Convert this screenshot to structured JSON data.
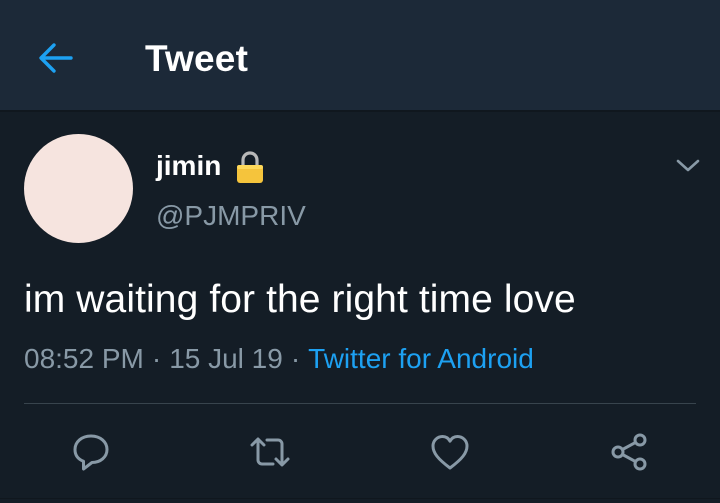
{
  "header": {
    "title": "Tweet",
    "back_icon": "arrow-left-icon"
  },
  "tweet": {
    "display_name": "jimin",
    "protected_icon": "lock-icon",
    "username": "@PJMPRIV",
    "text": "im waiting for the right time love",
    "time": "08:52 PM",
    "separator": "·",
    "date": "15 Jul 19",
    "source": "Twitter for Android",
    "more_icon": "chevron-down-icon"
  },
  "actions": [
    {
      "name": "reply",
      "icon": "reply-icon"
    },
    {
      "name": "retweet",
      "icon": "retweet-icon"
    },
    {
      "name": "like",
      "icon": "heart-icon"
    },
    {
      "name": "share",
      "icon": "share-icon"
    }
  ],
  "colors": {
    "background": "#141d26",
    "appbar": "#1c2938",
    "accent": "#1da1f2",
    "secondary_text": "#8899a6",
    "avatar": "#f6e4df"
  }
}
